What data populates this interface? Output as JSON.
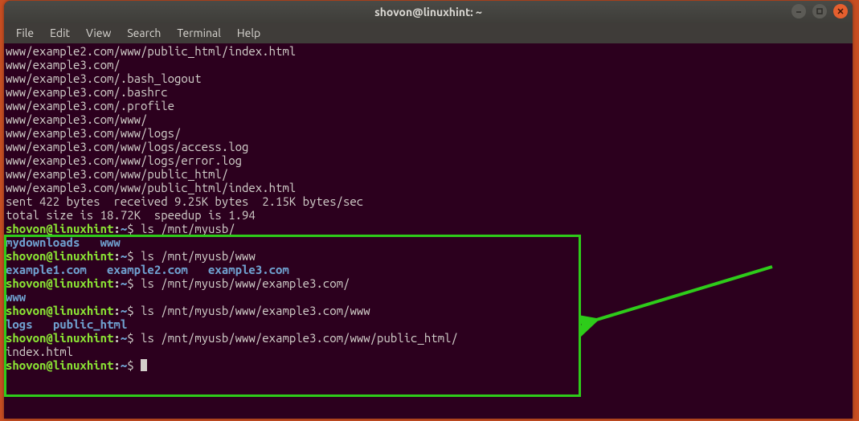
{
  "window": {
    "title": "shovon@linuxhint: ~"
  },
  "menubar": {
    "items": [
      "File",
      "Edit",
      "View",
      "Search",
      "Terminal",
      "Help"
    ]
  },
  "prompt": {
    "user": "shovon",
    "host": "linuxhint",
    "cwd": "~",
    "sep1": "@",
    "sep2": ":",
    "sigil": "$"
  },
  "scrollback": [
    "www/example2.com/www/public_html/index.html",
    "www/example3.com/",
    "www/example3.com/.bash_logout",
    "www/example3.com/.bashrc",
    "www/example3.com/.profile",
    "www/example3.com/www/",
    "www/example3.com/www/logs/",
    "www/example3.com/www/logs/access.log",
    "www/example3.com/www/logs/error.log",
    "www/example3.com/www/public_html/",
    "www/example3.com/www/public_html/index.html",
    "",
    "sent 422 bytes  received 9.25K bytes  2.15K bytes/sec",
    "total size is 18.72K  speedup is 1.94"
  ],
  "cmds": {
    "c1": " ls /mnt/myusb/",
    "c2": " ls /mnt/myusb/www",
    "c3": " ls /mnt/myusb/www/example3.com/",
    "c4": " ls /mnt/myusb/www/example3.com/www",
    "c5": " ls /mnt/myusb/www/example3.com/www/public_html/"
  },
  "out1": {
    "a": "mydownloads",
    "b": "www"
  },
  "out2": {
    "a": "example1.com",
    "b": "example2.com",
    "c": "example3.com"
  },
  "out3": {
    "a": "www"
  },
  "out4": {
    "a": "logs",
    "b": "public_html"
  },
  "out5": {
    "a": "index.html"
  },
  "spaces": {
    "s3": "   ",
    "s2": "  "
  }
}
